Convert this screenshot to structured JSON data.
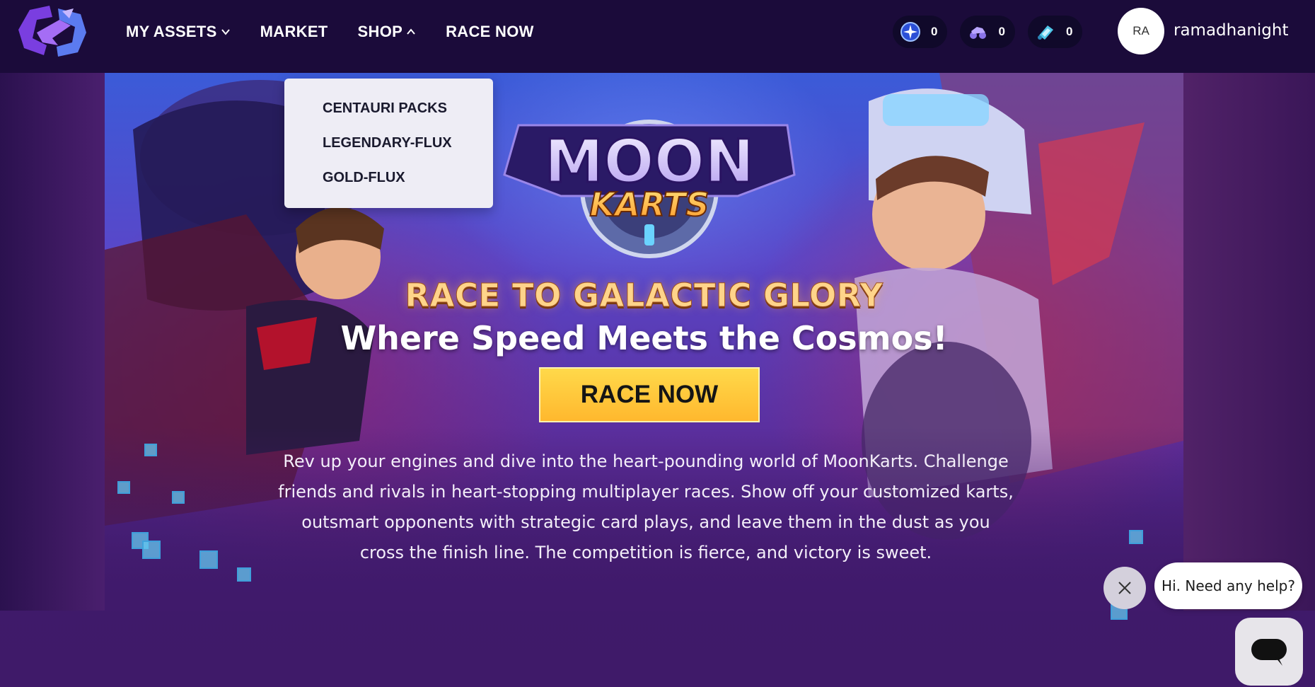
{
  "nav": {
    "items": [
      {
        "label": "MY ASSETS",
        "has_chevron": true,
        "chevron": "down"
      },
      {
        "label": "MARKET",
        "has_chevron": false
      },
      {
        "label": "SHOP",
        "has_chevron": true,
        "chevron": "up"
      },
      {
        "label": "RACE NOW",
        "has_chevron": false
      }
    ]
  },
  "counters": [
    {
      "icon": "star-token-icon",
      "value": "0"
    },
    {
      "icon": "kart-icon",
      "value": "0"
    },
    {
      "icon": "fuel-icon",
      "value": "0"
    }
  ],
  "user": {
    "initials": "RA",
    "name": "ramadhanight"
  },
  "shop_dropdown": {
    "items": [
      "CENTAURI PACKS",
      "LEGENDARY-FLUX",
      "GOLD-FLUX"
    ]
  },
  "hero": {
    "logo_top": "MOON",
    "logo_bottom": "KARTS",
    "headline": "RACE TO GALACTIC GLORY",
    "subheadline": "Where Speed Meets the Cosmos!",
    "cta": "RACE NOW",
    "description": "Rev up your engines and dive into the heart-pounding world of MoonKarts. Challenge friends and rivals in heart-stopping multiplayer races. Show off your customized karts, outsmart opponents with strategic card plays, and leave them in the dust as you cross the finish line. The competition is fierce, and victory is sweet."
  },
  "chat": {
    "bubble": "Hi. Need any help?"
  },
  "colors": {
    "topbar": "#1b0b3a",
    "cta": "#ffc63a",
    "background": "#401a6b"
  }
}
